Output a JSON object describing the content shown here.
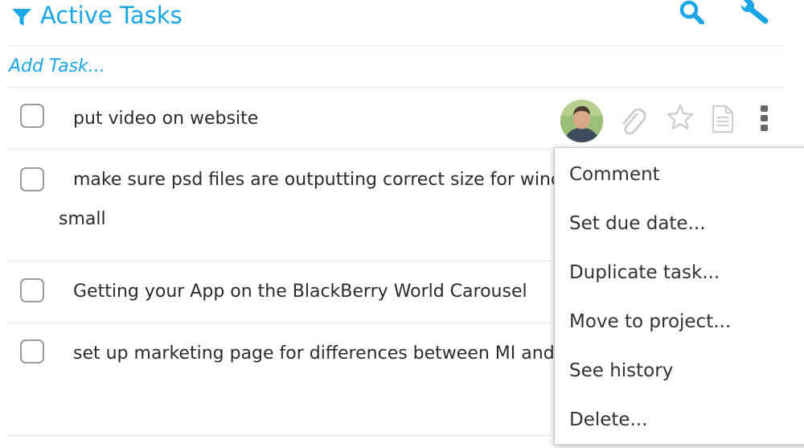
{
  "header": {
    "title": "Active Tasks",
    "filter_icon": "filter-icon",
    "search_icon": "search-icon",
    "settings_icon": "wrench-icon"
  },
  "add_task": {
    "placeholder": "Add Task..."
  },
  "tasks": [
    {
      "text": "put video on website",
      "checked": false
    },
    {
      "text": "make sure psd files are outputting correct size for wind",
      "text_cont": "small",
      "checked": false
    },
    {
      "text": "Getting your App on the BlackBerry World Carousel",
      "checked": false
    },
    {
      "text": "set up marketing page for differences between MI and",
      "checked": false
    }
  ],
  "row_actions": {
    "avatar": "avatar-icon",
    "attach": "paperclip-icon",
    "star": "star-icon",
    "note": "note-icon",
    "more": "more-vertical-icon"
  },
  "context_menu": {
    "items": [
      "Comment",
      "Set due date...",
      "Duplicate task...",
      "Move to project...",
      "See history",
      "Delete..."
    ]
  },
  "colors": {
    "accent": "#1aa6e6",
    "text": "#2b2b2b",
    "checkbox_border": "#9a9a9a",
    "divider": "#e6e6e6",
    "icon_muted": "#cfcfcf",
    "more_icon": "#666666"
  }
}
